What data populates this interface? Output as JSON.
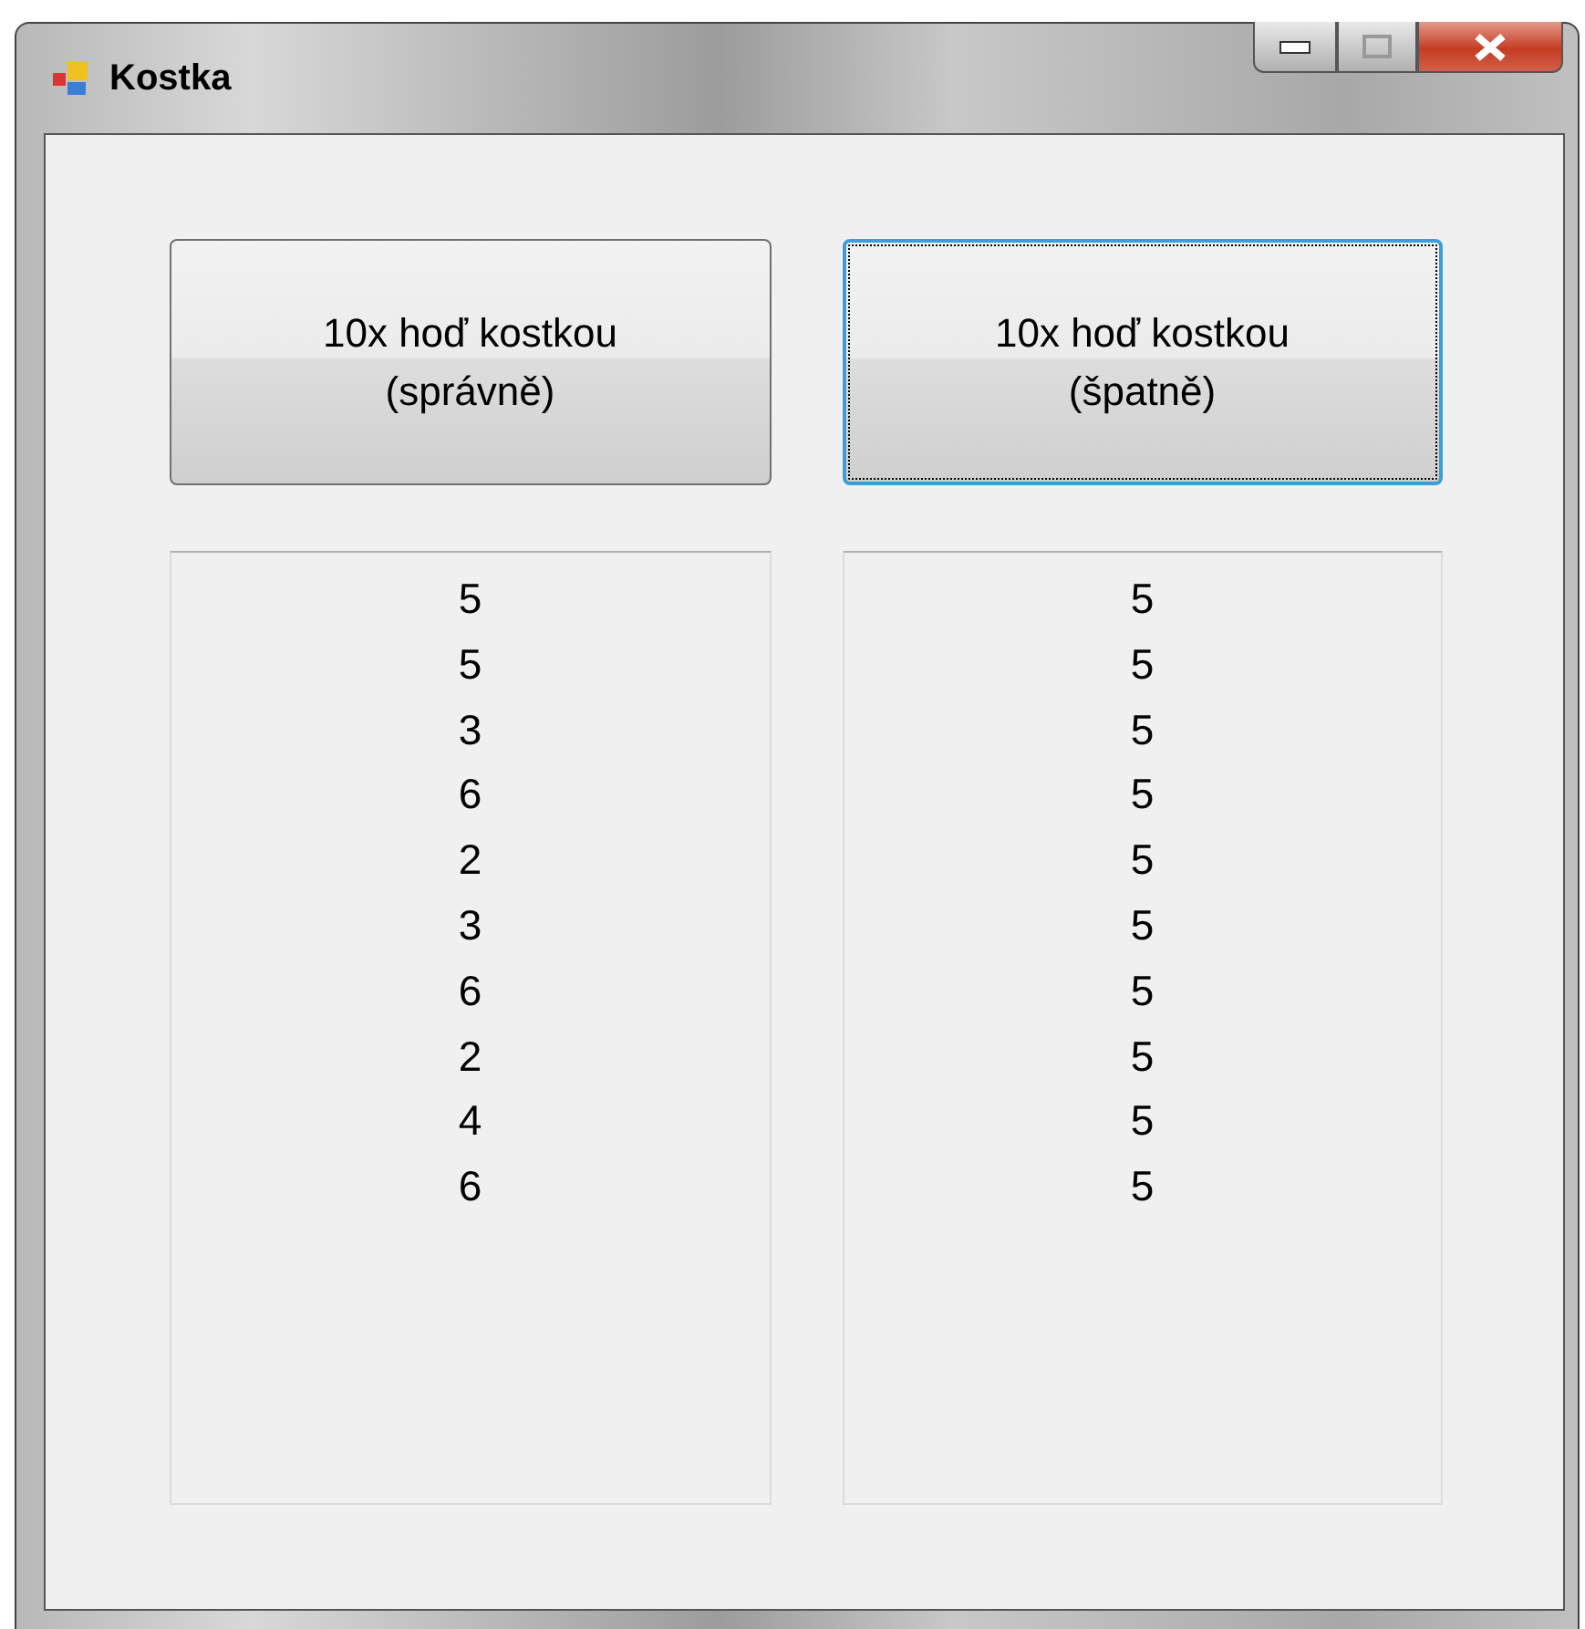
{
  "window": {
    "title": "Kostka",
    "controls": [
      {
        "kind": "minimize"
      },
      {
        "kind": "maximize"
      },
      {
        "kind": "close"
      }
    ]
  },
  "buttons": [
    {
      "label": "10x hoď kostkou\n(správně)",
      "focused": false
    },
    {
      "label": "10x hoď kostkou\n(špatně)",
      "focused": true
    }
  ],
  "lists": [
    {
      "items": [
        "5",
        "5",
        "3",
        "6",
        "2",
        "3",
        "6",
        "2",
        "4",
        "6"
      ]
    },
    {
      "items": [
        "5",
        "5",
        "5",
        "5",
        "5",
        "5",
        "5",
        "5",
        "5",
        "5"
      ]
    }
  ]
}
